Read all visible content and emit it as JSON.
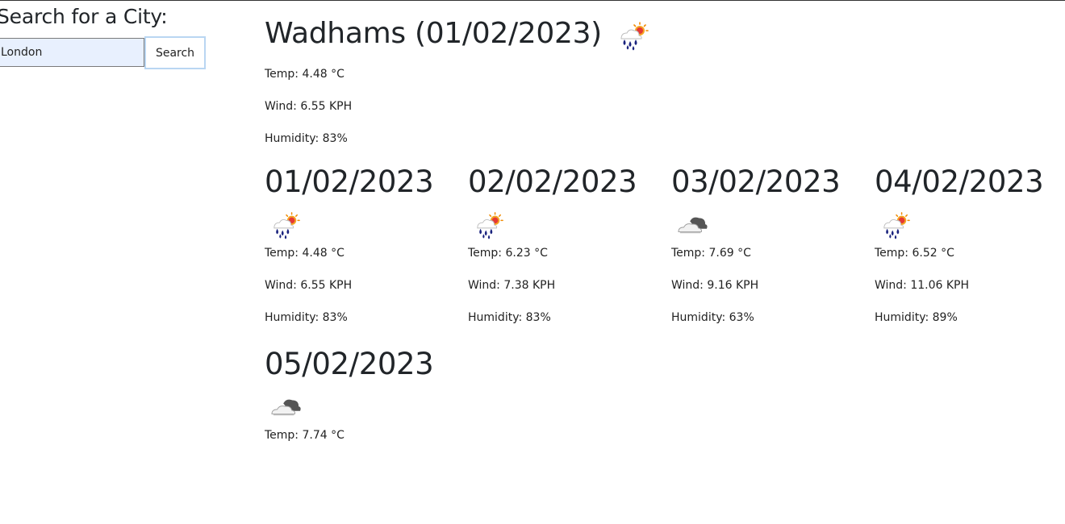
{
  "search": {
    "title": "Search for a City:",
    "input_value": "London",
    "button_label": "Search"
  },
  "current": {
    "title": "Wadhams (01/02/2023)",
    "icon": "rain-sun-icon",
    "temp": "Temp: 4.48 °C",
    "wind": "Wind: 6.55 KPH",
    "humidity": "Humidity: 83%"
  },
  "forecast": [
    {
      "date": "01/02/2023",
      "icon": "rain-sun-icon",
      "temp": "Temp: 4.48 °C",
      "wind": "Wind: 6.55 KPH",
      "humidity": "Humidity: 83%"
    },
    {
      "date": "02/02/2023",
      "icon": "rain-sun-icon",
      "temp": "Temp: 6.23 °C",
      "wind": "Wind: 7.38 KPH",
      "humidity": "Humidity: 83%"
    },
    {
      "date": "03/02/2023",
      "icon": "cloud-icon",
      "temp": "Temp: 7.69 °C",
      "wind": "Wind: 9.16 KPH",
      "humidity": "Humidity: 63%"
    },
    {
      "date": "04/02/2023",
      "icon": "rain-sun-icon",
      "temp": "Temp: 6.52 °C",
      "wind": "Wind: 11.06 KPH",
      "humidity": "Humidity: 89%"
    },
    {
      "date": "05/02/2023",
      "icon": "cloud-icon",
      "temp": "Temp: 7.74 °C",
      "wind": "",
      "humidity": ""
    }
  ]
}
